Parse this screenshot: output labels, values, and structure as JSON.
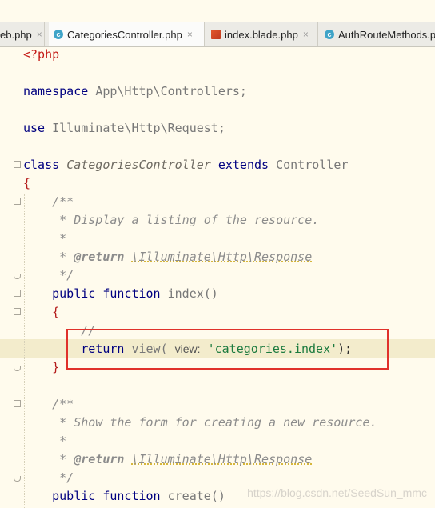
{
  "tabs": [
    {
      "label": "eb.php",
      "icon": "php-file-icon",
      "active": false
    },
    {
      "label": "CategoriesController.php",
      "icon": "php-class-icon",
      "active": true
    },
    {
      "label": "index.blade.php",
      "icon": "blade-file-icon",
      "active": false
    },
    {
      "label": "AuthRouteMethods.p",
      "icon": "php-class-icon",
      "active": false
    }
  ],
  "close_glyph": "×",
  "class_icon_glyph": "c",
  "code": {
    "php_open": "<?php",
    "namespace_kw": "namespace",
    "namespace_val": "App\\Http\\Controllers;",
    "use_kw": "use",
    "use_val": "Illuminate\\Http\\Request;",
    "class_kw": "class",
    "class_name": "CategoriesController",
    "extends_kw": "extends",
    "parent_class": "Controller",
    "brace_open": "{",
    "brace_close": "}",
    "doc_open": "/**",
    "doc1_text": " * Display a listing of the resource.",
    "doc_star": " *",
    "doc_return_prefix": " * ",
    "return_tag": "@return",
    "doc_return_type": "\\Illuminate\\Http\\Response",
    "doc_close": " */",
    "public_kw": "public",
    "function_kw": "function",
    "method_index": "index()",
    "inline_comment": "//",
    "return_kw": "return",
    "view_call": "view(",
    "param_hint": "view:",
    "view_arg": "'categories.index'",
    "call_end": ");",
    "doc2_text": " * Show the form for creating a new resource.",
    "method_create": "create()"
  },
  "colors": {
    "editor_bg": "#fffbed",
    "keyword": "#000080",
    "string": "#1b7a3e",
    "comment": "#8c8c8c",
    "highlight_box": "#e0312b"
  },
  "watermark": "https://blog.csdn.net/SeedSun_mmc"
}
